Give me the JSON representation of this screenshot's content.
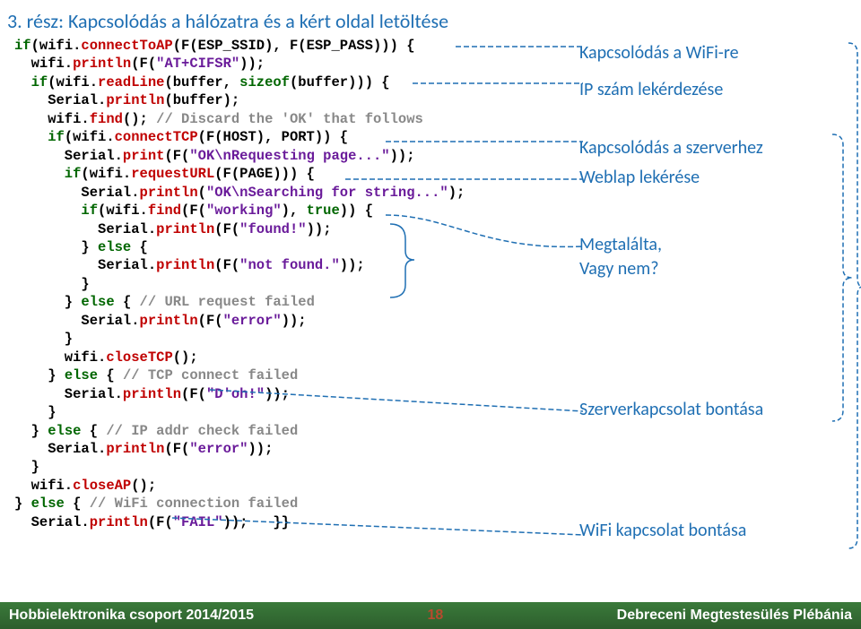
{
  "title": "3. rész: Kapcsolódás a hálózatra és a kért oldal letöltése",
  "code": {
    "l1a": "if",
    "l1b": "(wifi.",
    "l1c": "connectToAP",
    "l1d": "(F(ESP_SSID), F(ESP_PASS))) {",
    "l2a": "  wifi.",
    "l2b": "println",
    "l2c": "(F(",
    "l2d": "\"AT+CIFSR\"",
    "l2e": "));",
    "l3a": "  if",
    "l3b": "(wifi.",
    "l3c": "readLine",
    "l3d": "(buffer, ",
    "l3e": "sizeof",
    "l3f": "(buffer))) {",
    "l4a": "    Serial.",
    "l4b": "println",
    "l4c": "(buffer);",
    "l5a": "    wifi.",
    "l5b": "find",
    "l5c": "(); ",
    "l5d": "// Discard the 'OK' that follows",
    "l6a": "    if",
    "l6b": "(wifi.",
    "l6c": "connectTCP",
    "l6d": "(F(HOST), PORT)) {",
    "l7a": "      Serial.",
    "l7b": "print",
    "l7c": "(F(",
    "l7d": "\"OK\\nRequesting page...\"",
    "l7e": "));",
    "l8a": "      if",
    "l8b": "(wifi.",
    "l8c": "requestURL",
    "l8d": "(F(PAGE))) {",
    "l9a": "        Serial.",
    "l9b": "println",
    "l9c": "(",
    "l9d": "\"OK\\nSearching for string...\"",
    "l9e": ");",
    "l10a": "        if",
    "l10b": "(wifi.",
    "l10c": "find",
    "l10d": "(F(",
    "l10e": "\"working\"",
    "l10f": "), ",
    "l10g": "true",
    "l10h": ")) {",
    "l11a": "          Serial.",
    "l11b": "println",
    "l11c": "(F(",
    "l11d": "\"found!\"",
    "l11e": "));",
    "l12a": "        } ",
    "l12b": "else",
    "l12c": " {",
    "l13a": "          Serial.",
    "l13b": "println",
    "l13c": "(F(",
    "l13d": "\"not found.\"",
    "l13e": "));",
    "l14": "        }",
    "l15a": "      } ",
    "l15b": "else",
    "l15c": " { ",
    "l15d": "// URL request failed",
    "l16a": "        Serial.",
    "l16b": "println",
    "l16c": "(F(",
    "l16d": "\"error\"",
    "l16e": "));",
    "l17": "      }",
    "l18a": "      wifi.",
    "l18b": "closeTCP",
    "l18c": "();",
    "l19a": "    } ",
    "l19b": "else",
    "l19c": " { ",
    "l19d": "// TCP connect failed",
    "l20a": "      Serial.",
    "l20b": "println",
    "l20c": "(F(",
    "l20d": "\"D'oh!\"",
    "l20e": "));",
    "l21": "    }",
    "l22a": "  } ",
    "l22b": "else",
    "l22c": " { ",
    "l22d": "// IP addr check failed",
    "l23a": "    Serial.",
    "l23b": "println",
    "l23c": "(F(",
    "l23d": "\"error\"",
    "l23e": "));",
    "l24": "  }",
    "l25a": "  wifi.",
    "l25b": "closeAP",
    "l25c": "();",
    "l26a": "} ",
    "l26b": "else",
    "l26c": " { ",
    "l26d": "// WiFi connection failed",
    "l27a": "  Serial.",
    "l27b": "println",
    "l27c": "(F(",
    "l27d": "\"FAIL\"",
    "l27e": "));   }}"
  },
  "anno": {
    "a1": "Kapcsolódás a WiFi-re",
    "a2": "IP szám lekérdezése",
    "a3": "Kapcsolódás a szerverhez",
    "a4": "Weblap lekérése",
    "a5a": "Megtalálta,",
    "a5b": "Vagy nem?",
    "a6": "Szerverkapcsolat bontása",
    "a7": "WiFi kapcsolat bontása"
  },
  "footer": {
    "left": "Hobbielektronika csoport 2014/2015",
    "page": "18",
    "right": "Debreceni Megtestesülés Plébánia"
  }
}
